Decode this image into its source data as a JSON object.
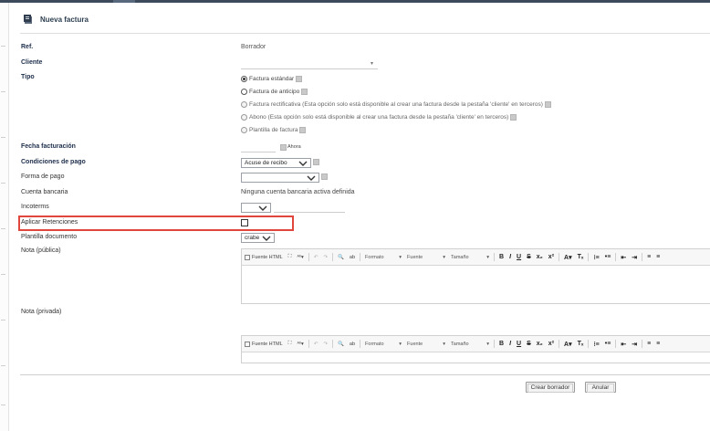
{
  "page": {
    "title": "Nueva factura"
  },
  "fields": {
    "ref_label": "Ref.",
    "ref_value": "Borrador",
    "cliente_label": "Cliente",
    "tipo_label": "Tipo",
    "fecha_label": "Fecha facturación",
    "fecha_ahora": "Ahora",
    "condiciones_label": "Condiciones de pago",
    "condiciones_value": "Acuse de recibo",
    "forma_pago_label": "Forma de pago",
    "forma_pago_value": "",
    "cuenta_label": "Cuenta bancaria",
    "cuenta_value": "Ninguna cuenta bancaria activa definida",
    "incoterms_label": "Incoterms",
    "retenciones_label": "Aplicar Retenciones",
    "plantilla_label": "Plantilla documento",
    "plantilla_value": "crabe",
    "nota_publica_label": "Nota (pública)",
    "nota_privada_label": "Nota (privada)"
  },
  "tipo_options": [
    {
      "label": "Factura estándar",
      "selected": true,
      "enabled": true
    },
    {
      "label": "Factura de anticipo",
      "selected": false,
      "enabled": true
    },
    {
      "label": "Factura rectificativa (Esta opción solo está disponible al crear una factura desde la pestaña 'cliente' en terceros)",
      "selected": false,
      "enabled": false
    },
    {
      "label": "Abono (Esta opción solo está disponible al crear una factura desde la pestaña 'cliente' en terceros)",
      "selected": false,
      "enabled": false
    },
    {
      "label": "Plantilla de factura",
      "selected": false,
      "enabled": false
    }
  ],
  "editor_toolbar": {
    "source": "Fuente HTML",
    "formato": "Formato",
    "fuente": "Fuente",
    "tamano": "Tamaño"
  },
  "buttons": {
    "crear_borrador": "Crear borrador",
    "anular": "Anular"
  },
  "colors": {
    "highlight": "#e0463c",
    "title": "#2c3e50",
    "label_bold": "#1c2d4a"
  }
}
